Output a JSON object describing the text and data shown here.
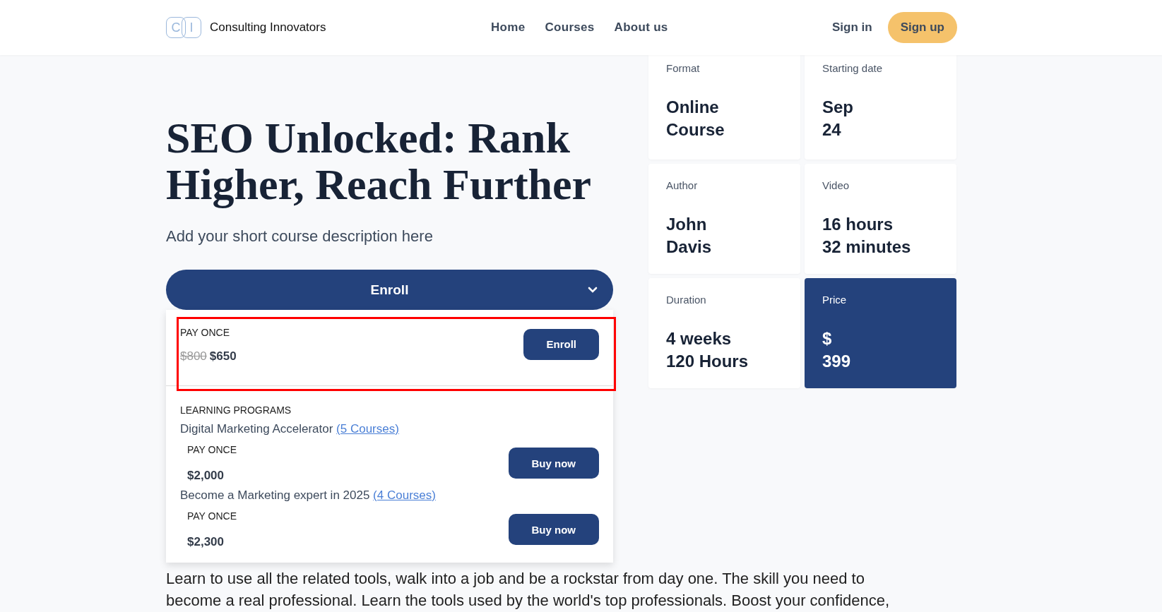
{
  "header": {
    "logo": {
      "letters": [
        "C",
        "I"
      ],
      "name": "Consulting Innovators"
    },
    "nav": [
      "Home",
      "Courses",
      "About us"
    ],
    "sign_in": "Sign in",
    "sign_up": "Sign up"
  },
  "hero": {
    "title": "SEO Unlocked: Rank Higher, Reach Further",
    "description": "Add your short course description here"
  },
  "enroll": {
    "label": "Enroll",
    "expanded": true,
    "pay_once": {
      "label": "PAY ONCE",
      "old_price": "$800",
      "price": "$650",
      "button": "Enroll",
      "highlighted": true
    },
    "programs": {
      "heading": "LEARNING PROGRAMS",
      "items": [
        {
          "name": "Digital Marketing Accelerator",
          "link": "(5 Courses)",
          "plan": "PAY ONCE",
          "price": "$2,000",
          "button": "Buy now"
        },
        {
          "name": "Become a Marketing expert in 2025",
          "link": "(4 Courses)",
          "plan": "PAY ONCE",
          "price": "$2,300",
          "button": "Buy now"
        }
      ]
    }
  },
  "details": [
    {
      "label": "Format",
      "lines": [
        "Online",
        "Course"
      ],
      "kind": "plain"
    },
    {
      "label": "Starting date",
      "lines": [
        "Sep",
        "24"
      ],
      "kind": "plain"
    },
    {
      "label": "Author",
      "lines": [
        "John",
        "Davis"
      ],
      "kind": "plain"
    },
    {
      "label": "Video",
      "lines": [
        "16 hours",
        "32 minutes"
      ],
      "kind": "plain"
    },
    {
      "label": "Duration",
      "lines": [
        "4 weeks",
        "120 Hours"
      ],
      "kind": "plain"
    },
    {
      "label": "Price",
      "lines": [
        "$",
        "399"
      ],
      "kind": "accent"
    }
  ],
  "about": "Learn to use all the related tools, walk into a job and be a rockstar from day one. The skill you need to become a real professional. Learn the tools used by the world's top professionals. Boost your confidence,"
}
